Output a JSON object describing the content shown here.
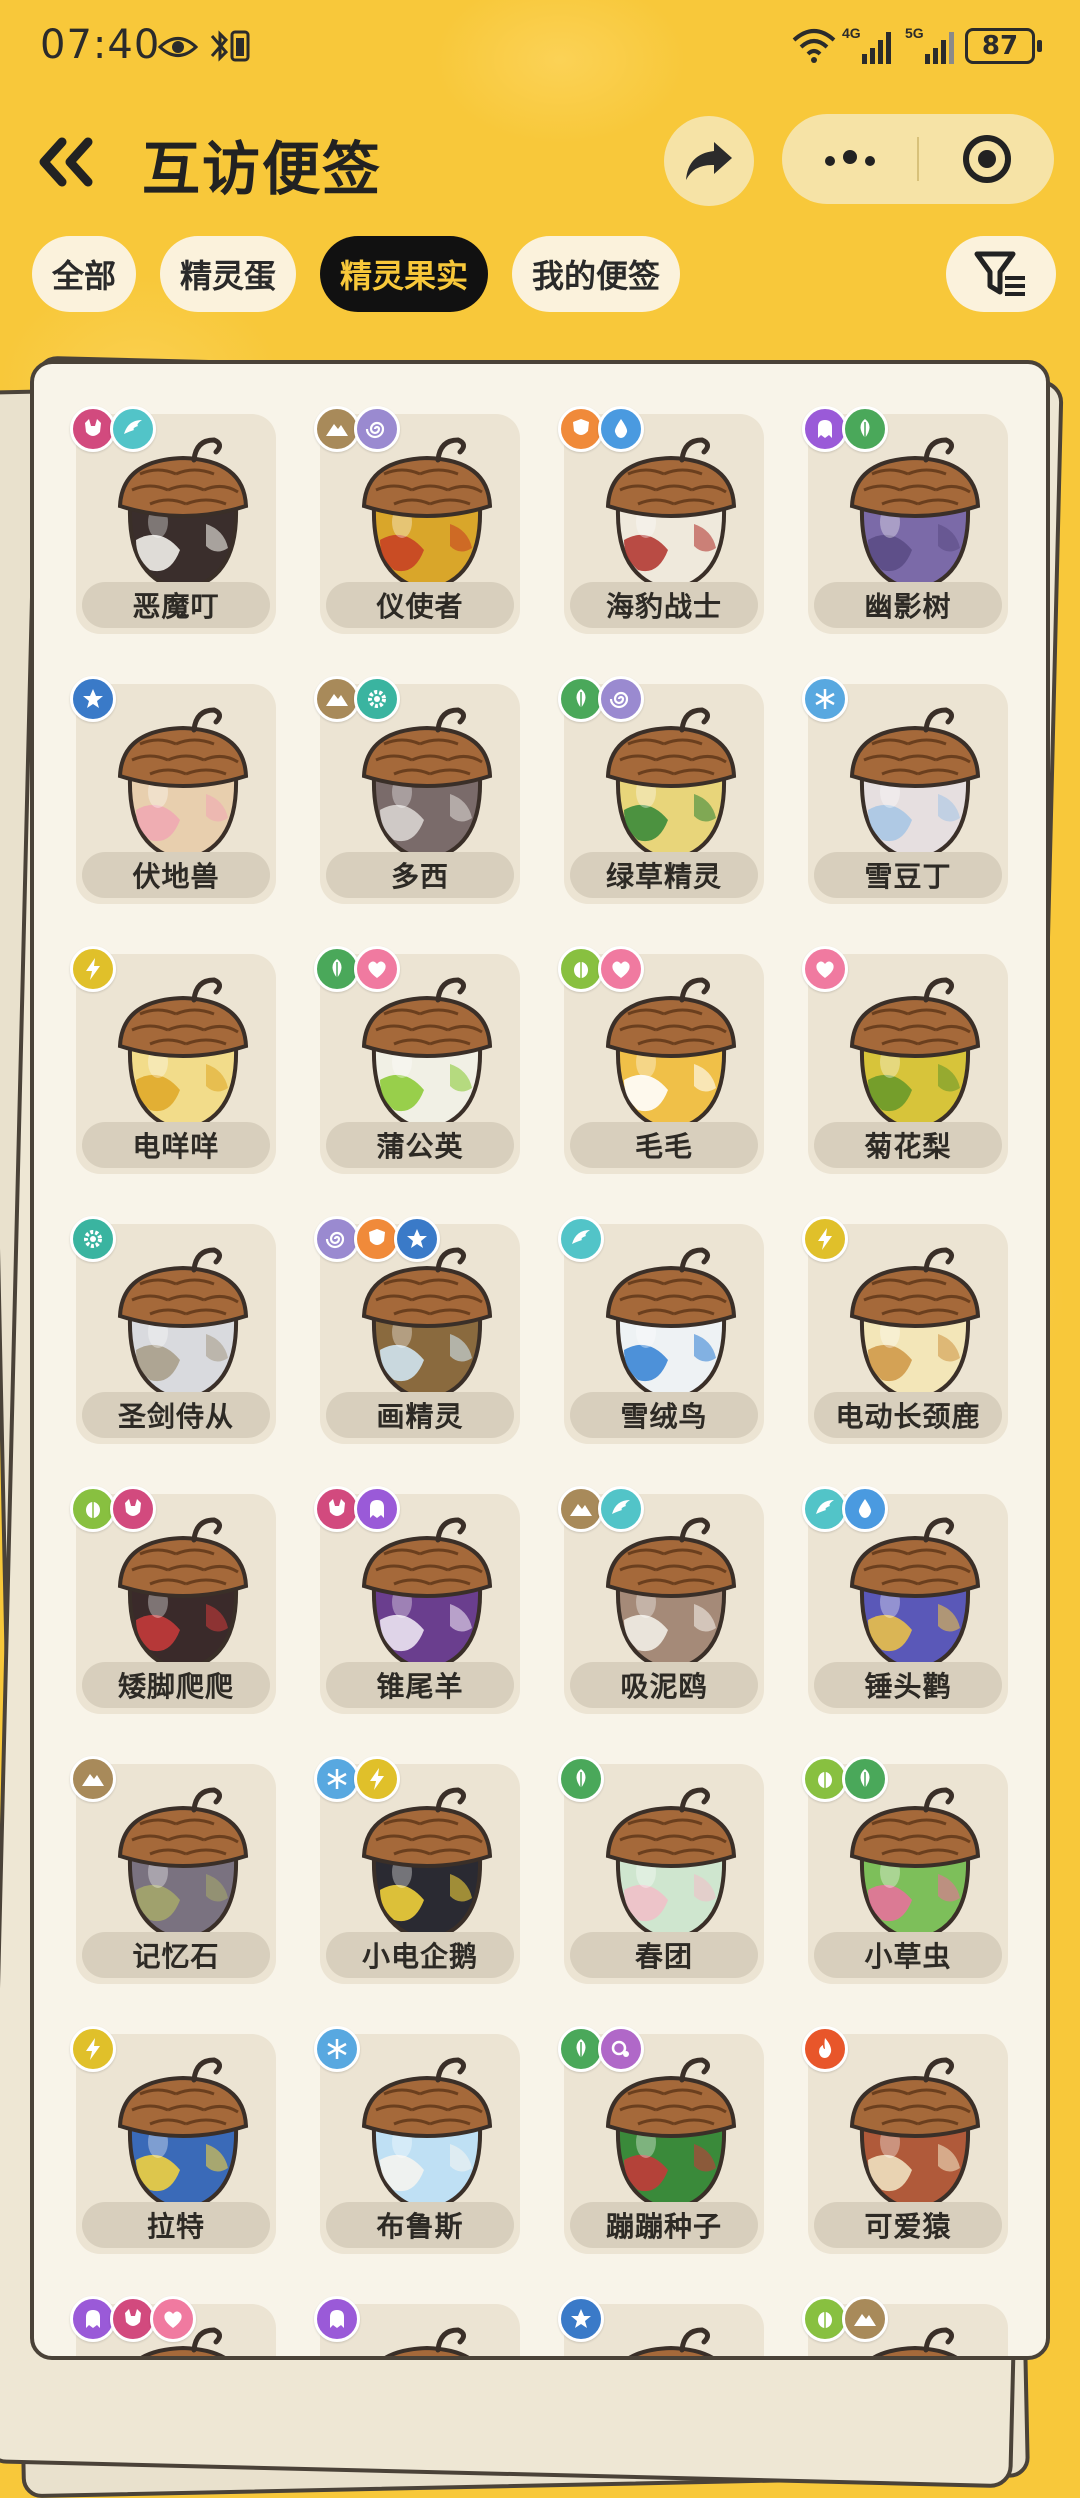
{
  "status_bar": {
    "time": "07:40",
    "battery": "87",
    "net1": "4G",
    "net2": "5G"
  },
  "header": {
    "title": "互访便签"
  },
  "tabs": [
    {
      "label": "全部",
      "active": false
    },
    {
      "label": "精灵蛋",
      "active": false
    },
    {
      "label": "精灵果实",
      "active": true
    },
    {
      "label": "我的便签",
      "active": false
    }
  ],
  "colors": {
    "background": "#f8c83a",
    "active_tab": "#111111",
    "card": "#f8f4e9"
  },
  "items": [
    {
      "name": "恶魔叮",
      "badges": [
        "demon",
        "wing"
      ],
      "body": "#3a2e2c",
      "patch": "#f2f0ea"
    },
    {
      "name": "仪使者",
      "badges": [
        "mountain",
        "swirl"
      ],
      "body": "#d9a62a",
      "patch": "#c64323"
    },
    {
      "name": "海豹战士",
      "badges": [
        "shield",
        "water"
      ],
      "body": "#efe9dc",
      "patch": "#b23a33"
    },
    {
      "name": "幽影树",
      "badges": [
        "ghost",
        "leaf"
      ],
      "body": "#7b6aa8",
      "patch": "#5b4c85"
    },
    {
      "name": "伏地兽",
      "badges": [
        "star",
        ""
      ],
      "body": "#e8cfae",
      "patch": "#f0a8b2"
    },
    {
      "name": "多西",
      "badges": [
        "mountain",
        "gear"
      ],
      "body": "#7a6b6a",
      "patch": "#d8d4d0"
    },
    {
      "name": "绿草精灵",
      "badges": [
        "leaf",
        "swirl"
      ],
      "body": "#e8d57a",
      "patch": "#3b8b3a"
    },
    {
      "name": "雪豆丁",
      "badges": [
        "snow",
        ""
      ],
      "body": "#e6dfe0",
      "patch": "#a9c7e4"
    },
    {
      "name": "电咩咩",
      "badges": [
        "bolt",
        ""
      ],
      "body": "#f2dc8a",
      "patch": "#e0aa2a"
    },
    {
      "name": "蒲公英",
      "badges": [
        "leaf",
        "heart"
      ],
      "body": "#f1f0e5",
      "patch": "#8ecb3a"
    },
    {
      "name": "毛毛",
      "badges": [
        "bug",
        "heart"
      ],
      "body": "#f0c048",
      "patch": "#ffffff"
    },
    {
      "name": "菊花梨",
      "badges": [
        "heart",
        ""
      ],
      "body": "#d7c43a",
      "patch": "#6a9a2a"
    },
    {
      "name": "圣剑侍从",
      "badges": [
        "gear",
        ""
      ],
      "body": "#d9dade",
      "patch": "#a89f8b"
    },
    {
      "name": "画精灵",
      "badges": [
        "swirl",
        "shield",
        "star"
      ],
      "body": "#8a6a3e",
      "patch": "#cfe4f0"
    },
    {
      "name": "雪绒鸟",
      "badges": [
        "wing",
        ""
      ],
      "body": "#eef2f4",
      "patch": "#3b86d6"
    },
    {
      "name": "电动长颈鹿",
      "badges": [
        "bolt",
        ""
      ],
      "body": "#f3e6b8",
      "patch": "#d09a4a"
    },
    {
      "name": "矮脚爬爬",
      "badges": [
        "bug",
        "demon"
      ],
      "body": "#3a2a2a",
      "patch": "#c43a3a"
    },
    {
      "name": "锥尾羊",
      "badges": [
        "demon",
        "ghost"
      ],
      "body": "#6a3e8e",
      "patch": "#ece4f2"
    },
    {
      "name": "吸泥鸥",
      "badges": [
        "mountain",
        "wing"
      ],
      "body": "#a58a78",
      "patch": "#f2ede6"
    },
    {
      "name": "锤头鹳",
      "badges": [
        "wing",
        "water"
      ],
      "body": "#5a58b8",
      "patch": "#e8c04a"
    },
    {
      "name": "记忆石",
      "badges": [
        "mountain",
        ""
      ],
      "body": "#7a7280",
      "patch": "#a4a66a"
    },
    {
      "name": "小电企鹅",
      "badges": [
        "snow",
        "bolt"
      ],
      "body": "#2a2a32",
      "patch": "#f0d03a"
    },
    {
      "name": "春团",
      "badges": [
        "leaf",
        ""
      ],
      "body": "#cfe6cf",
      "patch": "#f0c0c8"
    },
    {
      "name": "小草虫",
      "badges": [
        "bug",
        "leaf"
      ],
      "body": "#7dbf5a",
      "patch": "#e6729a"
    },
    {
      "name": "拉特",
      "badges": [
        "bolt",
        ""
      ],
      "body": "#3a6ab8",
      "patch": "#f0d040"
    },
    {
      "name": "布鲁斯",
      "badges": [
        "snow",
        ""
      ],
      "body": "#bfe0f4",
      "patch": "#f4f4f0"
    },
    {
      "name": "蹦蹦种子",
      "badges": [
        "leaf",
        "bubble"
      ],
      "body": "#3a8a3a",
      "patch": "#c23a3a"
    },
    {
      "name": "可爱猿",
      "badges": [
        "fire",
        ""
      ],
      "body": "#b05a3a",
      "patch": "#f0e0c0"
    },
    {
      "name": "",
      "badges": [
        "ghost",
        "demon",
        "heart"
      ],
      "body": "#d9c9b0",
      "patch": "#d9c9b0"
    },
    {
      "name": "",
      "badges": [
        "ghost",
        ""
      ],
      "body": "#d9c9b0",
      "patch": "#d9c9b0"
    },
    {
      "name": "",
      "badges": [
        "star",
        ""
      ],
      "body": "#d9c9b0",
      "patch": "#d9c9b0"
    },
    {
      "name": "",
      "badges": [
        "bug",
        "mountain"
      ],
      "body": "#d9c9b0",
      "patch": "#d9c9b0"
    }
  ]
}
